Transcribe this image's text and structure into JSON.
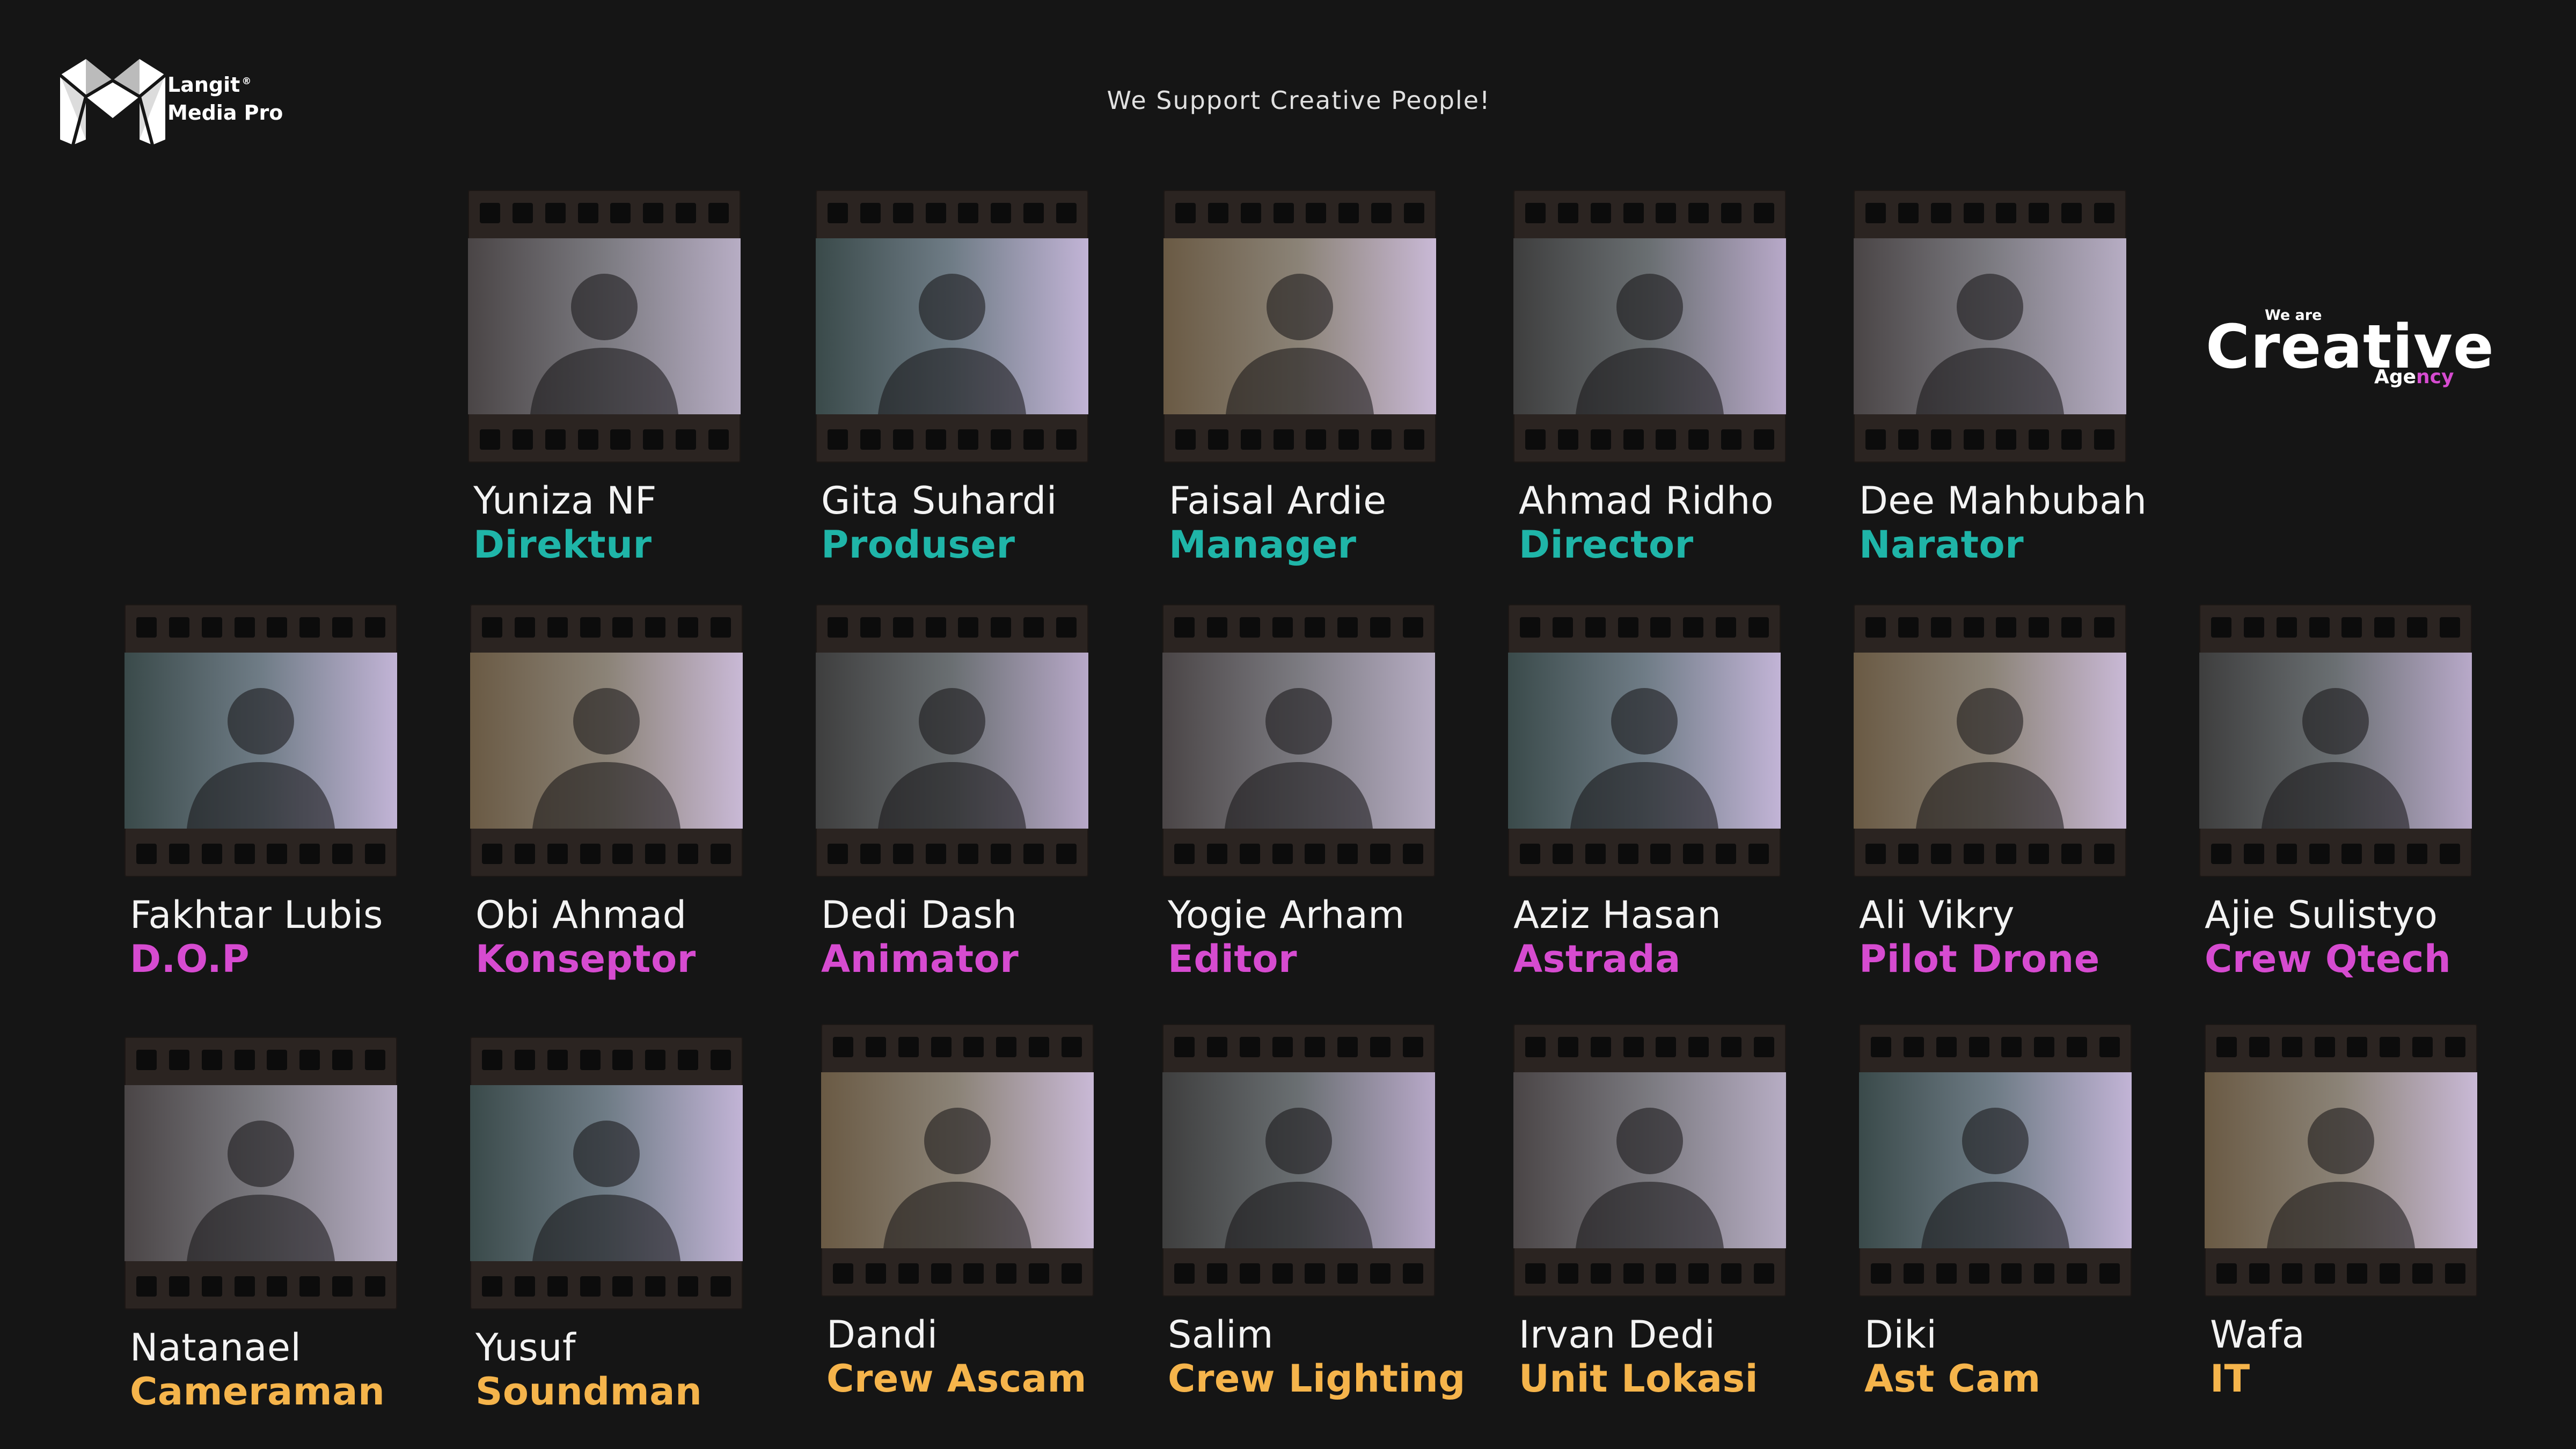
{
  "logo": {
    "line1": "Langit",
    "registered": "®",
    "line2": "Media Pro"
  },
  "tagline": "We Support Creative People!",
  "badge": {
    "we_are": "We are",
    "title": "Creative",
    "agency_part1": "Age",
    "agency_part2": "ncy"
  },
  "colors": {
    "background": "#151515",
    "teal": "#1fb5a8",
    "pink": "#d64bd0",
    "orange": "#f5b44b",
    "text": "#f3f3f3"
  },
  "rows": [
    [
      {
        "name": "Yuniza NF",
        "role": "Direktur"
      },
      {
        "name": "Gita Suhardi",
        "role": "Produser"
      },
      {
        "name": "Faisal Ardie",
        "role": "Manager"
      },
      {
        "name": "Ahmad Ridho",
        "role": "Director"
      },
      {
        "name": "Dee Mahbubah",
        "role": "Narator"
      }
    ],
    [
      {
        "name": "Fakhtar Lubis",
        "role": "D.O.P"
      },
      {
        "name": "Obi Ahmad",
        "role": "Konseptor"
      },
      {
        "name": "Dedi Dash",
        "role": "Animator"
      },
      {
        "name": "Yogie Arham",
        "role": "Editor"
      },
      {
        "name": "Aziz Hasan",
        "role": "Astrada"
      },
      {
        "name": "Ali Vikry",
        "role": "Pilot Drone"
      },
      {
        "name": "Ajie Sulistyo",
        "role": "Crew Qtech"
      }
    ],
    [
      {
        "name": "Natanael",
        "role": "Cameraman"
      },
      {
        "name": "Yusuf",
        "role": "Soundman"
      },
      {
        "name": "Dandi",
        "role": "Crew Ascam"
      },
      {
        "name": "Salim",
        "role": "Crew Lighting"
      },
      {
        "name": "Irvan Dedi",
        "role": "Unit Lokasi"
      },
      {
        "name": "Diki",
        "role": "Ast Cam"
      },
      {
        "name": "Wafa",
        "role": "IT"
      }
    ]
  ]
}
